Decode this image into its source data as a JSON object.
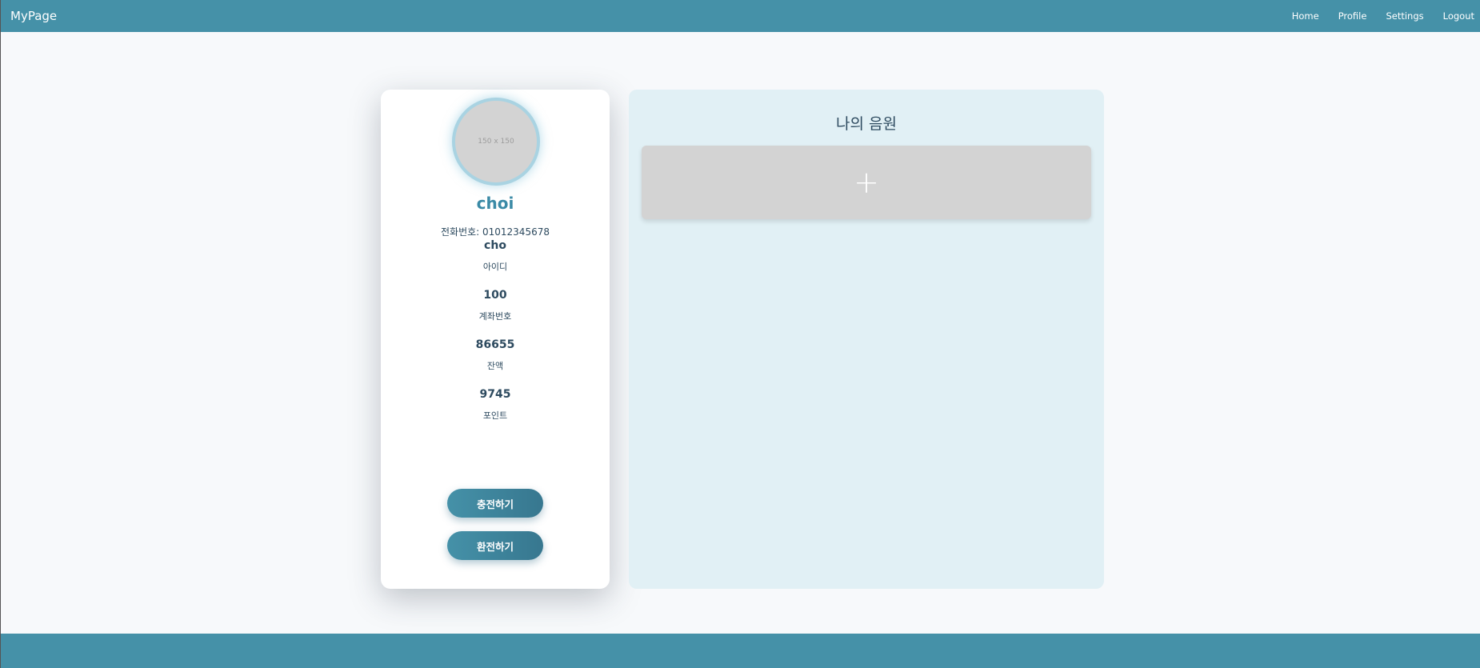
{
  "navbar": {
    "brand": "MyPage",
    "links": [
      "Home",
      "Profile",
      "Settings",
      "Logout"
    ]
  },
  "profile": {
    "avatar_placeholder": "150 x 150",
    "name": "choi",
    "phone": "전화번호: 01012345678",
    "stats": [
      {
        "value": "cho",
        "label": "아이디"
      },
      {
        "value": "100",
        "label": "계좌번호"
      },
      {
        "value": "86655",
        "label": "잔액"
      },
      {
        "value": "9745",
        "label": "포인트"
      }
    ],
    "charge_button": "충전하기",
    "exchange_button": "환전하기"
  },
  "music": {
    "title": "나의 음원",
    "add_icon": "+"
  },
  "colors": {
    "primary": "#4591a8",
    "panel": "#e1f0f5",
    "background": "#f7f9fb"
  }
}
